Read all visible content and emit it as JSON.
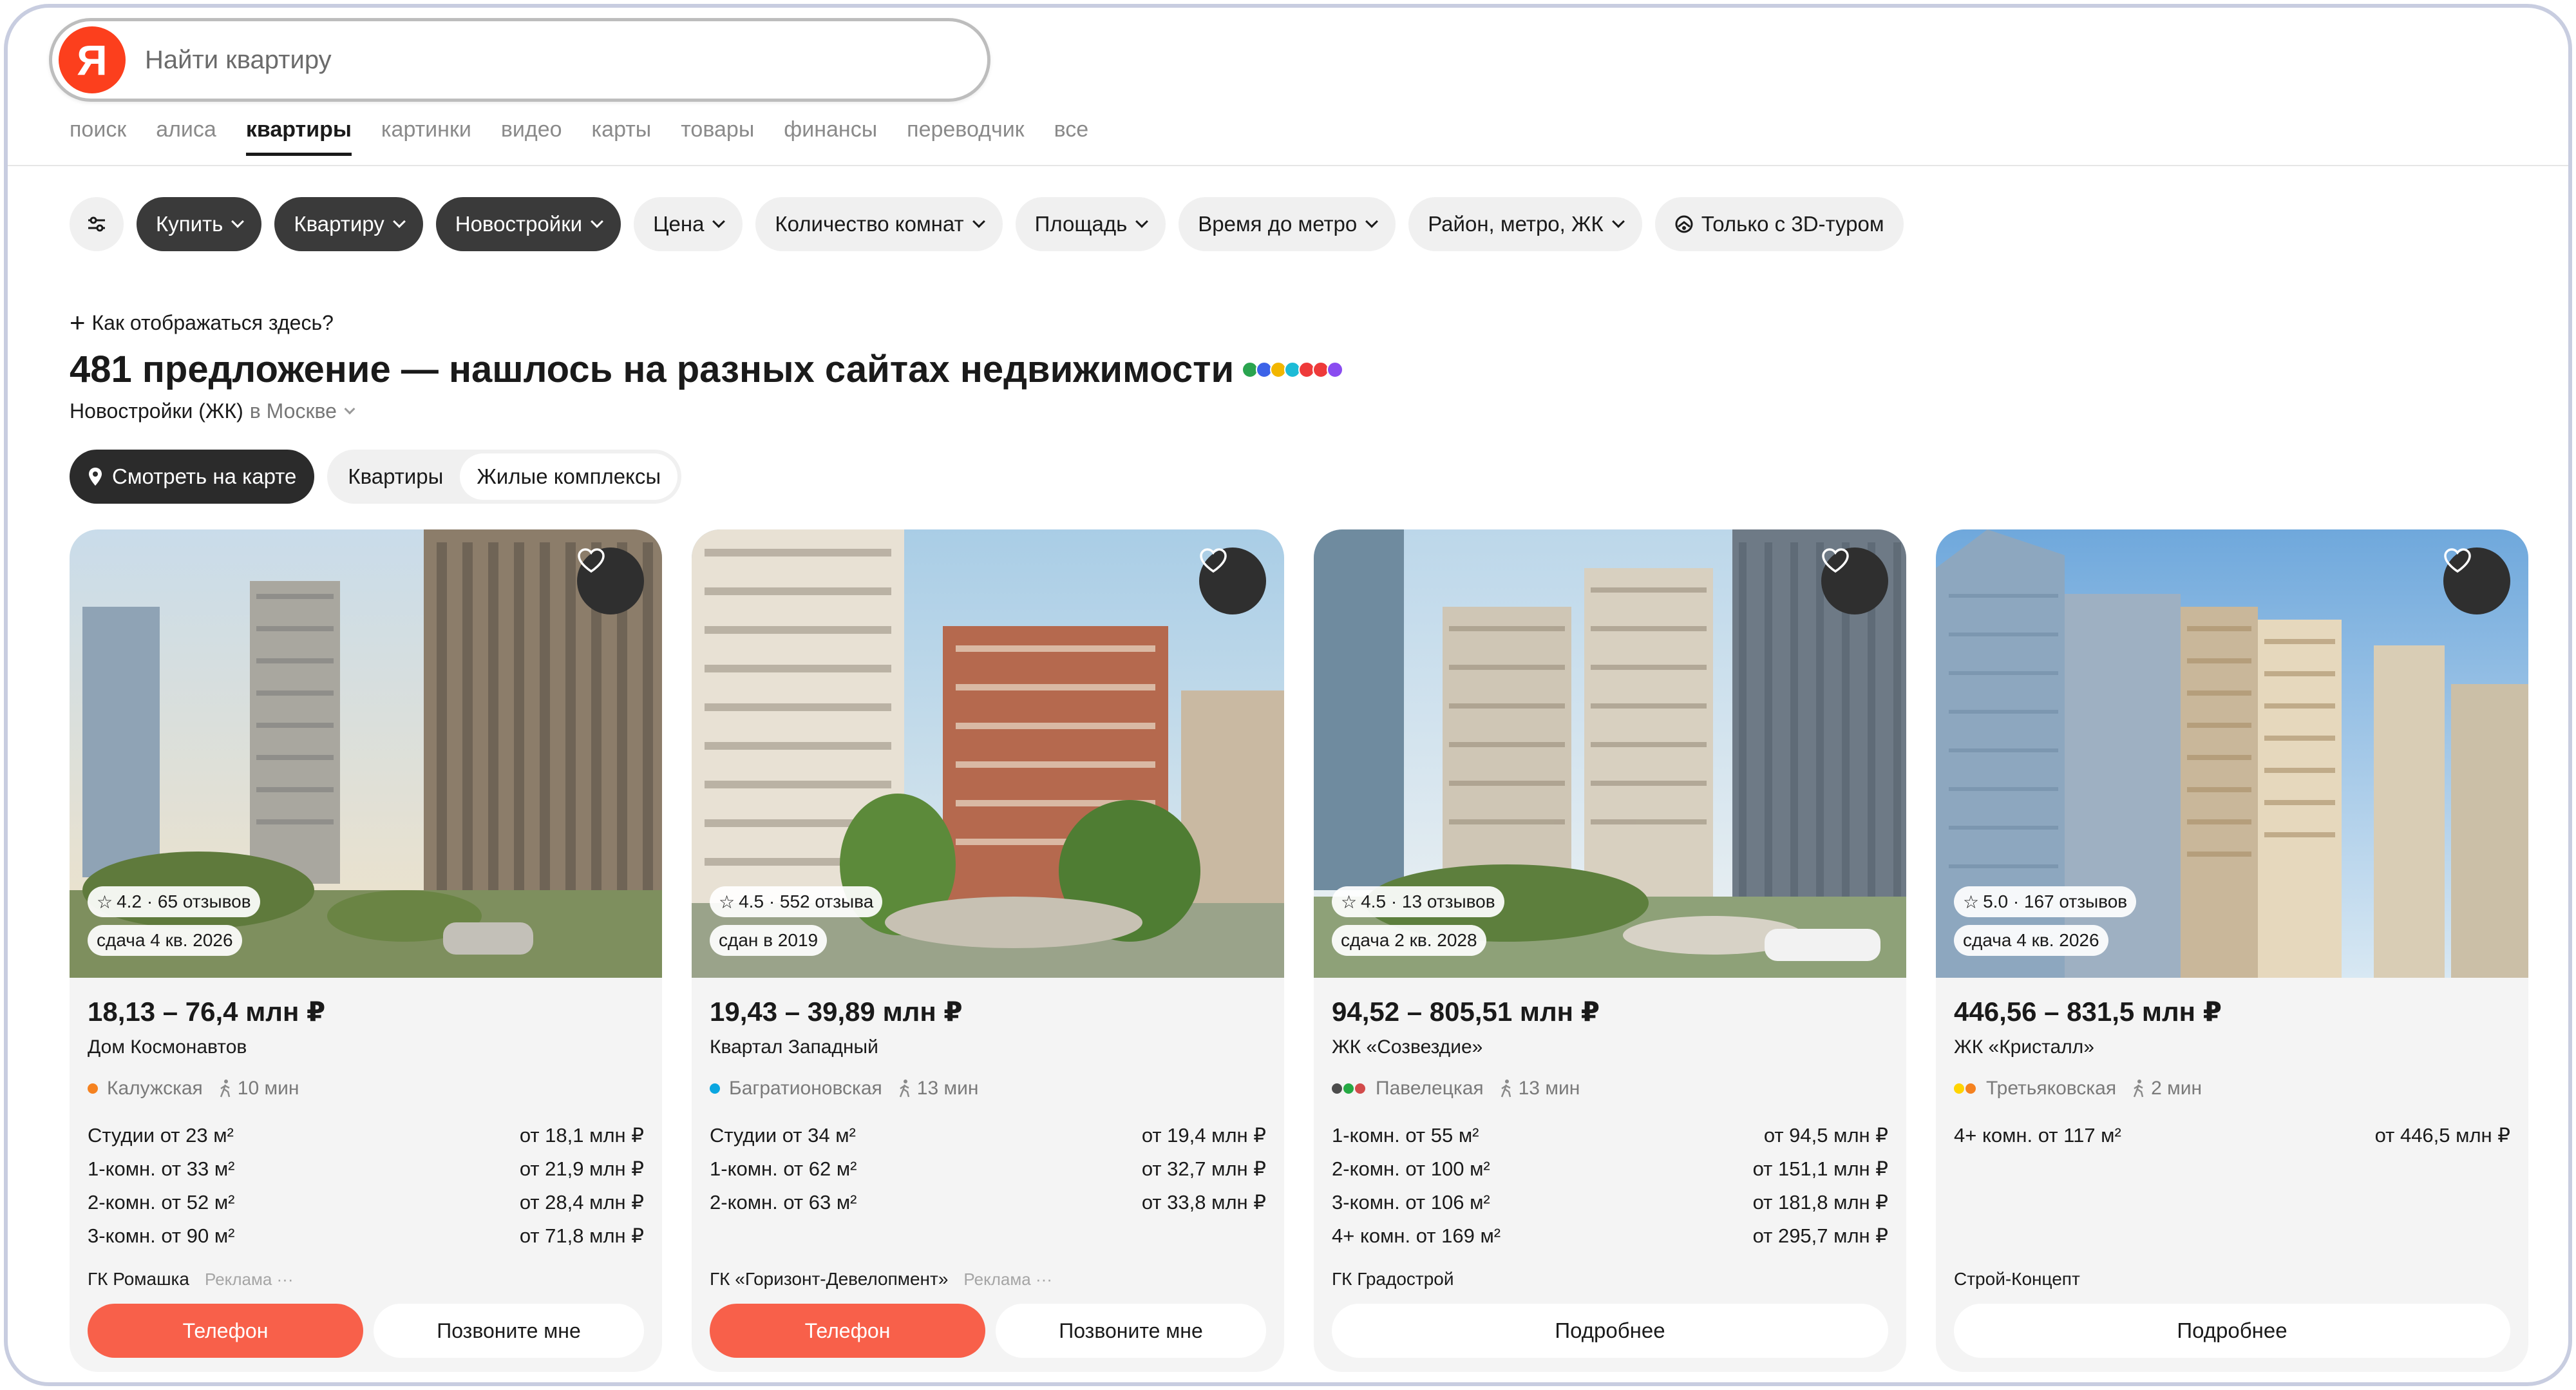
{
  "search": {
    "placeholder": "Найти квартиру",
    "logo_letter": "Я"
  },
  "nav": {
    "items": [
      "поиск",
      "алиса",
      "квартиры",
      "картинки",
      "видео",
      "карты",
      "товары",
      "финансы",
      "переводчик",
      "все"
    ],
    "active": "квартиры"
  },
  "filters": {
    "items": [
      {
        "label": "Купить",
        "style": "dark"
      },
      {
        "label": "Квартиру",
        "style": "dark"
      },
      {
        "label": "Новостройки",
        "style": "dark"
      },
      {
        "label": "Цена",
        "style": "light"
      },
      {
        "label": "Количество комнат",
        "style": "light"
      },
      {
        "label": "Площадь",
        "style": "light"
      },
      {
        "label": "Время до метро",
        "style": "light"
      },
      {
        "label": "Район, метро, ЖК",
        "style": "light"
      },
      {
        "label": "Только с 3D-туром",
        "style": "light"
      }
    ]
  },
  "header": {
    "how_to_appear": "Как отображаться здесь?",
    "headline": "481 предложение — нашлось на разных сайтах недвижимости",
    "category": "Новостройки (ЖК)",
    "city": "в Москве"
  },
  "views": {
    "map_button": "Смотреть на карте",
    "tabs": [
      "Квартиры",
      "Жилые комплексы"
    ],
    "active_tab": "Жилые комплексы"
  },
  "colors": {
    "accent": "#fc3f1d",
    "phone_button": "#f8604a",
    "dark_chip": "#3a3a3a",
    "site_icons": [
      "#2aa44f",
      "#3d63e8",
      "#f2b600",
      "#1dbbd6",
      "#ee3a3a",
      "#8a4cf0"
    ]
  },
  "cards": [
    {
      "rating": "4.2 · 65 отзывов",
      "handover": "сдача 4 кв. 2026",
      "price": "18,13 – 76,4 млн ₽",
      "name": "Дом Космонавтов",
      "metro": "Калужская",
      "metro_colors": [
        "#f58220"
      ],
      "walk": "10 мин",
      "offers": [
        {
          "type": "Студии от 23 м²",
          "price": "от 18,1 млн ₽"
        },
        {
          "type": "1-комн. от 33 м²",
          "price": "от 21,9 млн ₽"
        },
        {
          "type": "2-комн. от 52 м²",
          "price": "от 28,4 млн ₽"
        },
        {
          "type": "3-комн. от 90 м²",
          "price": "от 71,8 млн ₽"
        }
      ],
      "developer": "ГК Ромашка",
      "ad": "Реклама ···",
      "buttons": {
        "phone": "Телефон",
        "call": "Позвоните мне"
      }
    },
    {
      "rating": "4.5 · 552 отзыва",
      "handover": "сдан в 2019",
      "price": "19,43 – 39,89 млн ₽",
      "name": "Квартал Западный",
      "metro": "Багратионовская",
      "metro_colors": [
        "#0aa6e0"
      ],
      "walk": "13 мин",
      "offers": [
        {
          "type": "Студии от 34 м²",
          "price": "от 19,4 млн ₽"
        },
        {
          "type": "1-комн. от 62 м²",
          "price": "от 32,7 млн ₽"
        },
        {
          "type": "2-комн. от 63 м²",
          "price": "от 33,8 млн ₽"
        }
      ],
      "developer": "ГК «Горизонт-Девелопмент»",
      "ad": "Реклама ···",
      "buttons": {
        "phone": "Телефон",
        "call": "Позвоните мне"
      }
    },
    {
      "rating": "4.5 · 13 отзывов",
      "handover": "сдача 2 кв. 2028",
      "price": "94,52 – 805,51 млн ₽",
      "name": "ЖК «Созвездие»",
      "metro": "Павелецкая",
      "metro_colors": [
        "#4c4c4c",
        "#25a944",
        "#d24b4b"
      ],
      "walk": "13 мин",
      "offers": [
        {
          "type": "1-комн. от 55 м²",
          "price": "от 94,5 млн ₽"
        },
        {
          "type": "2-комн. от 100 м²",
          "price": "от 151,1 млн ₽"
        },
        {
          "type": "3-комн. от 106 м²",
          "price": "от 181,8 млн ₽"
        },
        {
          "type": "4+ комн. от 169 м²",
          "price": "от 295,7 млн ₽"
        }
      ],
      "developer": "ГК Градострой",
      "buttons": {
        "more": "Подробнее"
      }
    },
    {
      "rating": "5.0 · 167 отзывов",
      "handover": "сдача 4 кв. 2026",
      "price": "446,56 – 831,5 млн ₽",
      "name": "ЖК «Кристалл»",
      "metro": "Третьяковская",
      "metro_colors": [
        "#ffd400",
        "#f58220"
      ],
      "walk": "2 мин",
      "offers": [
        {
          "type": "4+ комн. от 117 м²",
          "price": "от 446,5 млн ₽"
        }
      ],
      "developer": "Строй-Концепт",
      "buttons": {
        "more": "Подробнее"
      }
    }
  ]
}
